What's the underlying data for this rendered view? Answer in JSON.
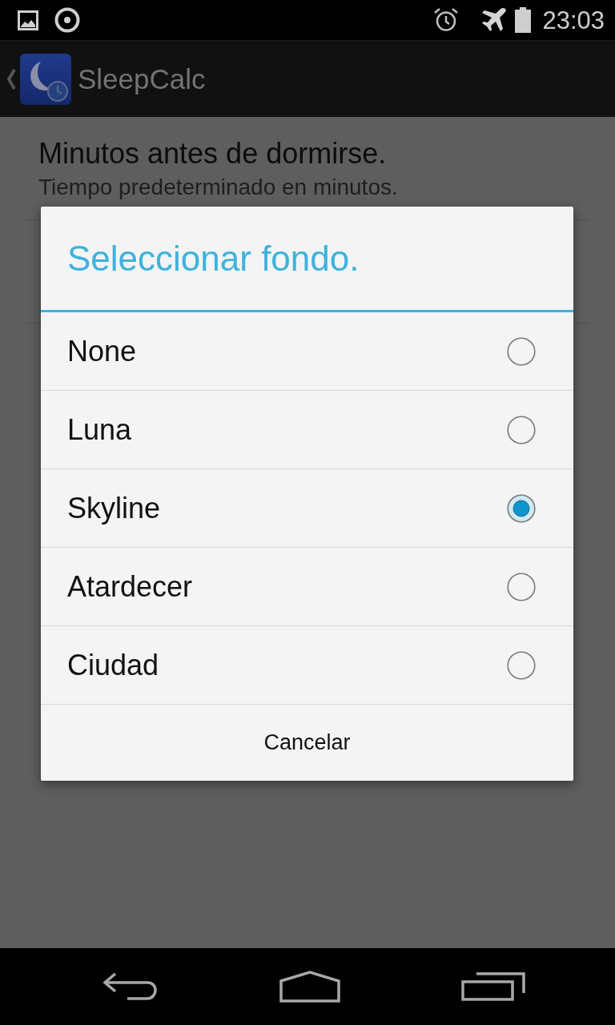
{
  "status_bar": {
    "time": "23:03"
  },
  "action_bar": {
    "title": "SleepCalc"
  },
  "preferences": [
    {
      "title": "Minutos antes de dormirse.",
      "summary": "Tiempo predeterminado en minutos."
    }
  ],
  "dialog": {
    "title": "Seleccionar fondo.",
    "options": [
      {
        "label": "None",
        "selected": false
      },
      {
        "label": "Luna",
        "selected": false
      },
      {
        "label": "Skyline",
        "selected": true
      },
      {
        "label": "Atardecer",
        "selected": false
      },
      {
        "label": "Ciudad",
        "selected": false
      }
    ],
    "buttons": [
      "Cancelar"
    ]
  }
}
